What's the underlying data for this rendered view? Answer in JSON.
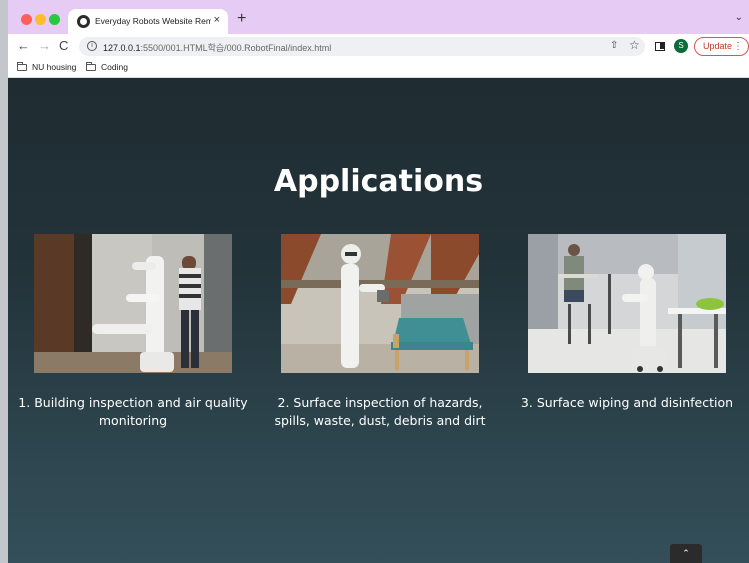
{
  "browser": {
    "tab_title": "Everyday Robots Website Remak",
    "tab_close": "×",
    "new_tab": "+",
    "url_host": "127.0.0.1",
    "url_rest": ":5500/001.HTML학습/000.RobotFinal/index.html",
    "profile_initial": "S",
    "update_label": "Update",
    "nav_back": "←",
    "nav_forward": "→",
    "nav_reload": "C"
  },
  "bookmarks": [
    {
      "label": "NU housing"
    },
    {
      "label": "Coding"
    }
  ],
  "page": {
    "heading": "Applications",
    "cards": [
      {
        "caption": "1. Building inspection and air quality monitoring"
      },
      {
        "caption": "2. Surface inspection of hazards, spills, waste, dust, debris and dirt"
      },
      {
        "caption": "3. Surface wiping and disinfection"
      }
    ],
    "scroll_top_icon": "chevron-up-icon"
  }
}
